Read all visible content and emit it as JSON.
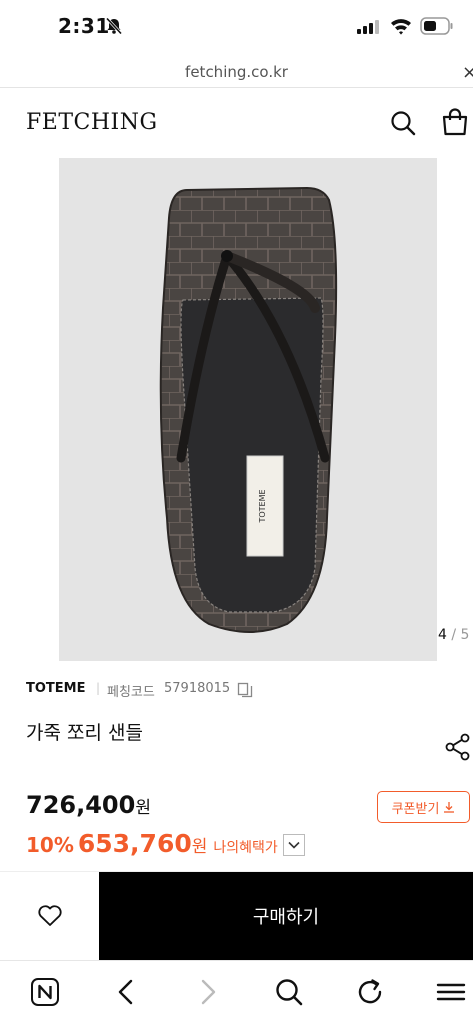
{
  "status_bar": {
    "time": "2:31"
  },
  "url_bar": {
    "url": "fetching.co.kr",
    "close": "×"
  },
  "header": {
    "logo": "FETCHING"
  },
  "gallery": {
    "current": "4",
    "separator": " / ",
    "total": "5",
    "label_text": "TOTEME"
  },
  "product": {
    "brand": "TOTEME",
    "separator": "|",
    "code_label": "페칭코드",
    "code_value": "57918015",
    "title": "가죽 쪼리 샌들"
  },
  "price": {
    "original": "726,400",
    "unit": "원",
    "discount_rate": "10%",
    "sale_price": "653,760",
    "benefit_label": "나의혜택가",
    "coupon_label": "쿠폰받기"
  },
  "buy_bar": {
    "buy_label": "구매하기"
  },
  "colors": {
    "accent": "#f25c2b",
    "buy_bg": "#000000",
    "image_bg": "#e4e4e4"
  }
}
